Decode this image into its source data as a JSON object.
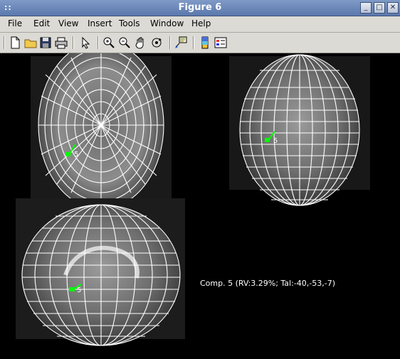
{
  "window": {
    "title": "Figure 6",
    "controls": [
      "minimize",
      "maximize",
      "close"
    ]
  },
  "menubar": {
    "items": [
      {
        "label": "File"
      },
      {
        "label": "Edit"
      },
      {
        "label": "View"
      },
      {
        "label": "Insert"
      },
      {
        "label": "Tools"
      },
      {
        "label": "Window"
      },
      {
        "label": "Help"
      }
    ]
  },
  "toolbar": {
    "buttons": [
      {
        "icon": "new-file-icon"
      },
      {
        "icon": "open-folder-icon"
      },
      {
        "icon": "save-icon"
      },
      {
        "icon": "print-icon"
      },
      {
        "icon": "pointer-arrow-icon"
      },
      {
        "icon": "zoom-in-icon"
      },
      {
        "icon": "zoom-out-icon"
      },
      {
        "icon": "pan-hand-icon"
      },
      {
        "icon": "rotate-3d-icon"
      },
      {
        "icon": "data-cursor-icon"
      },
      {
        "icon": "colorbar-icon"
      },
      {
        "icon": "legend-icon"
      }
    ]
  },
  "figure": {
    "marker_label": "5",
    "caption": "Comp. 5 (RV:3.29%; Tal:-40,-53,-7)",
    "marker_color": "#00ff00",
    "grid_color": "#ffffff"
  }
}
